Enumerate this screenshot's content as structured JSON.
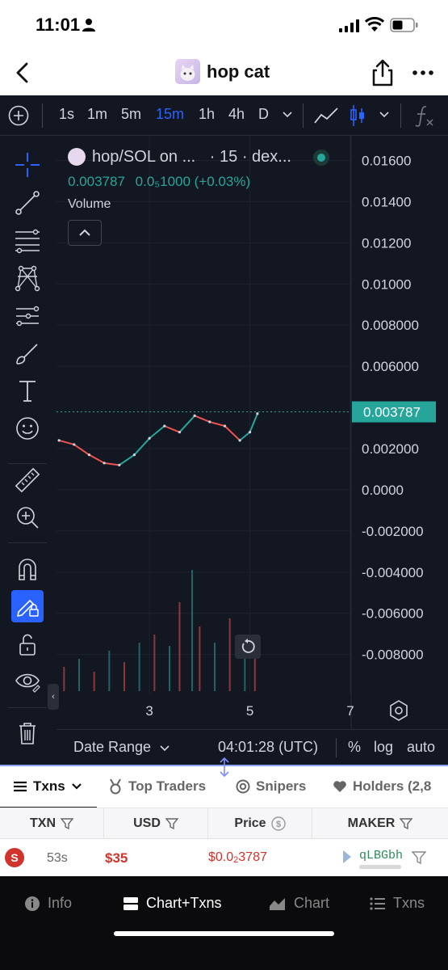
{
  "status_bar": {
    "time": "11:01"
  },
  "header": {
    "title": "hop cat"
  },
  "toolbar": {
    "intervals": [
      "1s",
      "1m",
      "5m",
      "15m",
      "1h",
      "4h",
      "D"
    ],
    "active_interval": "15m"
  },
  "chart": {
    "legend_symbol": "hop/SOL on ...",
    "legend_interval": "· 15 · dex...",
    "legend_price": "0.003787",
    "legend_change": "0.0₅1000 (+0.03%)",
    "volume_label": "Volume",
    "current_price_label": "0.003787",
    "utc_time": "04:01:28 (UTC)",
    "date_range_label": "Date Range",
    "percent_label": "%",
    "log_label": "log",
    "auto_label": "auto"
  },
  "chart_data": {
    "type": "line",
    "title": "hop/SOL on ... · 15 · dex...",
    "y_ticks": [
      "0.01600",
      "0.01400",
      "0.01200",
      "0.01000",
      "0.008000",
      "0.006000",
      "0.002000",
      "0.0000",
      "-0.002000",
      "-0.004000",
      "-0.006000",
      "-0.008000"
    ],
    "y_tick_values": [
      0.016,
      0.014,
      0.012,
      0.01,
      0.008,
      0.006,
      0.002,
      0,
      -0.002,
      -0.004,
      -0.006,
      -0.008
    ],
    "x_ticks": [
      "3",
      "5",
      "7"
    ],
    "x_tick_values": [
      3,
      5,
      7
    ],
    "xlim": [
      1.15,
      7.0
    ],
    "ylim": [
      -0.0099,
      0.0172
    ],
    "last_price": 0.003787,
    "price_x": [
      1.2,
      1.5,
      1.8,
      2.1,
      2.4,
      2.7,
      3.0,
      3.3,
      3.6,
      3.9,
      4.2,
      4.5,
      4.8,
      5.0,
      5.15
    ],
    "price_y": [
      0.0024,
      0.0022,
      0.0017,
      0.0013,
      0.0012,
      0.0017,
      0.0025,
      0.0031,
      0.0028,
      0.0036,
      0.0033,
      0.0031,
      0.0024,
      0.0028,
      0.0037
    ],
    "volume_x": [
      1.3,
      1.6,
      1.9,
      2.2,
      2.5,
      2.8,
      3.1,
      3.4,
      3.6,
      3.85,
      4.0,
      4.3,
      4.6,
      4.9,
      5.1
    ],
    "volume_rel": [
      0.15,
      0.2,
      0.12,
      0.25,
      0.18,
      0.3,
      0.35,
      0.28,
      0.55,
      0.75,
      0.4,
      0.3,
      0.45,
      0.2,
      0.35
    ],
    "grid": true
  },
  "tabs": [
    {
      "label": "Txns",
      "icon": "list-icon"
    },
    {
      "label": "Top Traders",
      "icon": "medal-icon"
    },
    {
      "label": "Snipers",
      "icon": "target-icon"
    },
    {
      "label": "Holders (2,8",
      "icon": "heart-icon"
    }
  ],
  "table": {
    "headers": [
      "TXN",
      "USD",
      "Price",
      "MAKER"
    ],
    "row": {
      "type": "S",
      "age": "53s",
      "usd": "$35",
      "price_prefix": "$0.0",
      "price_subscript": "2",
      "price_suffix": "3787",
      "maker": "qLBGbh"
    }
  },
  "bottom_nav": [
    "Info",
    "Chart+Txns",
    "Chart",
    "Txns"
  ],
  "colors": {
    "chart_bg": "#131722",
    "up": "#26a69a",
    "down": "#ef5350",
    "accent": "#2962ff",
    "sell": "#d0342c"
  }
}
